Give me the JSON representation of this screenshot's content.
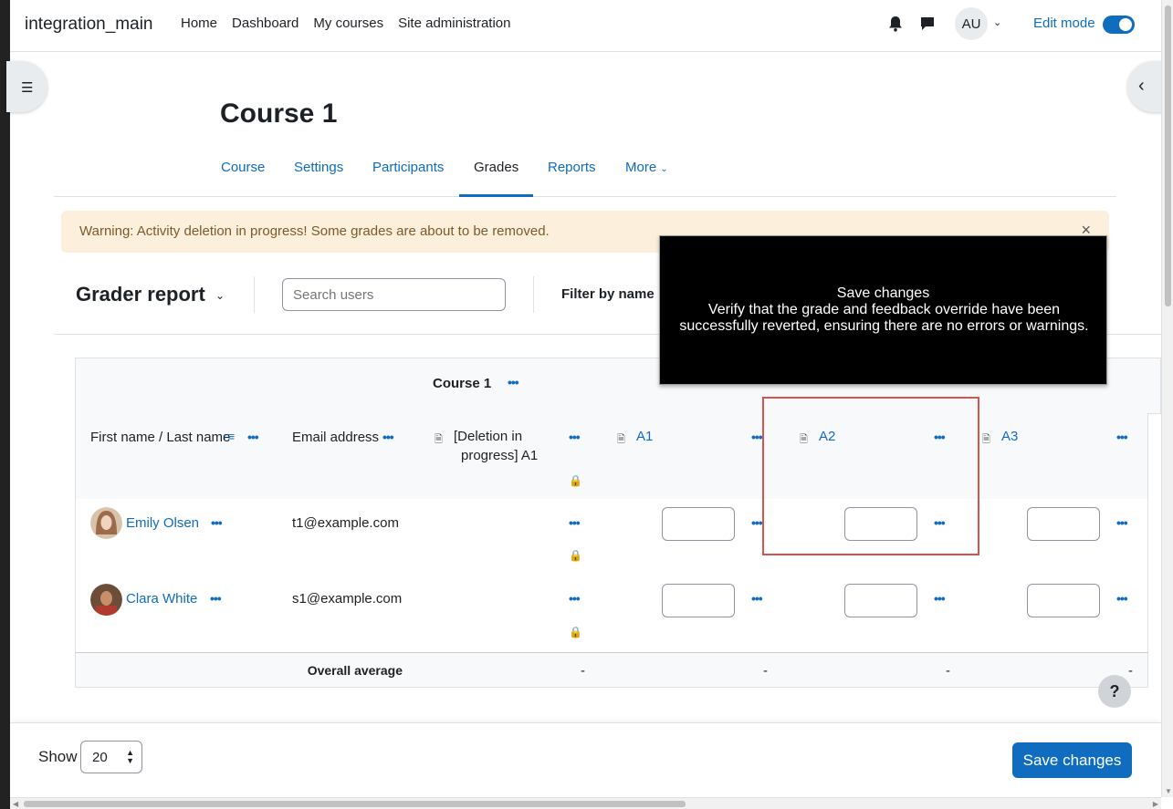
{
  "navbar": {
    "brand": "integration_main",
    "links": [
      "Home",
      "Dashboard",
      "My courses",
      "Site administration"
    ],
    "avatar_initials": "AU",
    "edit_mode_label": "Edit mode",
    "edit_mode_on": true
  },
  "header": {
    "course_title": "Course 1",
    "tabs": [
      "Course",
      "Settings",
      "Participants",
      "Grades",
      "Reports",
      "More"
    ],
    "active_tab": "Grades"
  },
  "warning": {
    "message": "Warning: Activity deletion in progress! Some grades are about to be removed.",
    "close_symbol": "×"
  },
  "tertiary": {
    "report_title": "Grader report",
    "search_placeholder": "Search users",
    "filter_label": "Filter by name"
  },
  "table": {
    "category_header": "Course 1",
    "columns": {
      "name": "First name / Last name",
      "email": "Email address",
      "deleted_item_line1": "[Deletion in",
      "deleted_item_line2": "progress] A1",
      "a1": "A1",
      "a2": "A2",
      "a3": "A3"
    },
    "rows": [
      {
        "name": "Emily Olsen",
        "email": "t1@example.com"
      },
      {
        "name": "Clara White",
        "email": "s1@example.com"
      }
    ],
    "overall_label": "Overall average",
    "overall_values": [
      "-",
      "-",
      "-",
      "-"
    ]
  },
  "tooltip": {
    "title": "Save changes",
    "body": "Verify that the grade and feedback override have been successfully reverted, ensuring there are no errors or warnings."
  },
  "help_label": "?",
  "footer": {
    "show_label": "Show",
    "show_value": "20",
    "save_label": "Save changes"
  },
  "colors": {
    "primary": "#0f6cbf",
    "warning_bg": "#fcefdc",
    "highlight": "#d9534f"
  }
}
